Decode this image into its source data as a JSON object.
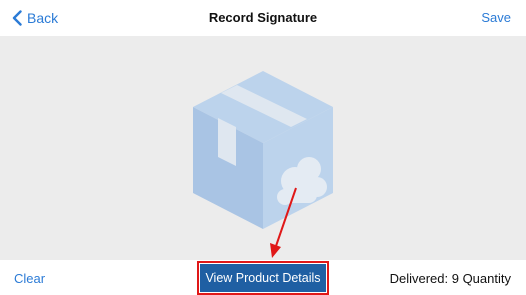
{
  "navbar": {
    "back_label": "Back",
    "title": "Record Signature",
    "save_label": "Save",
    "back_icon": "chevron-left-icon"
  },
  "canvas": {
    "illustration": "package-cloud-icon",
    "background_color": "#ececec",
    "illustration_color": "#b8d0ea"
  },
  "footer": {
    "clear_label": "Clear",
    "details_label": "View Product Details",
    "delivered_text": "Delivered: 9 Quantity"
  },
  "colors": {
    "accent": "#2b7bd6",
    "button": "#1f5fa3",
    "highlight": "#e01818"
  }
}
